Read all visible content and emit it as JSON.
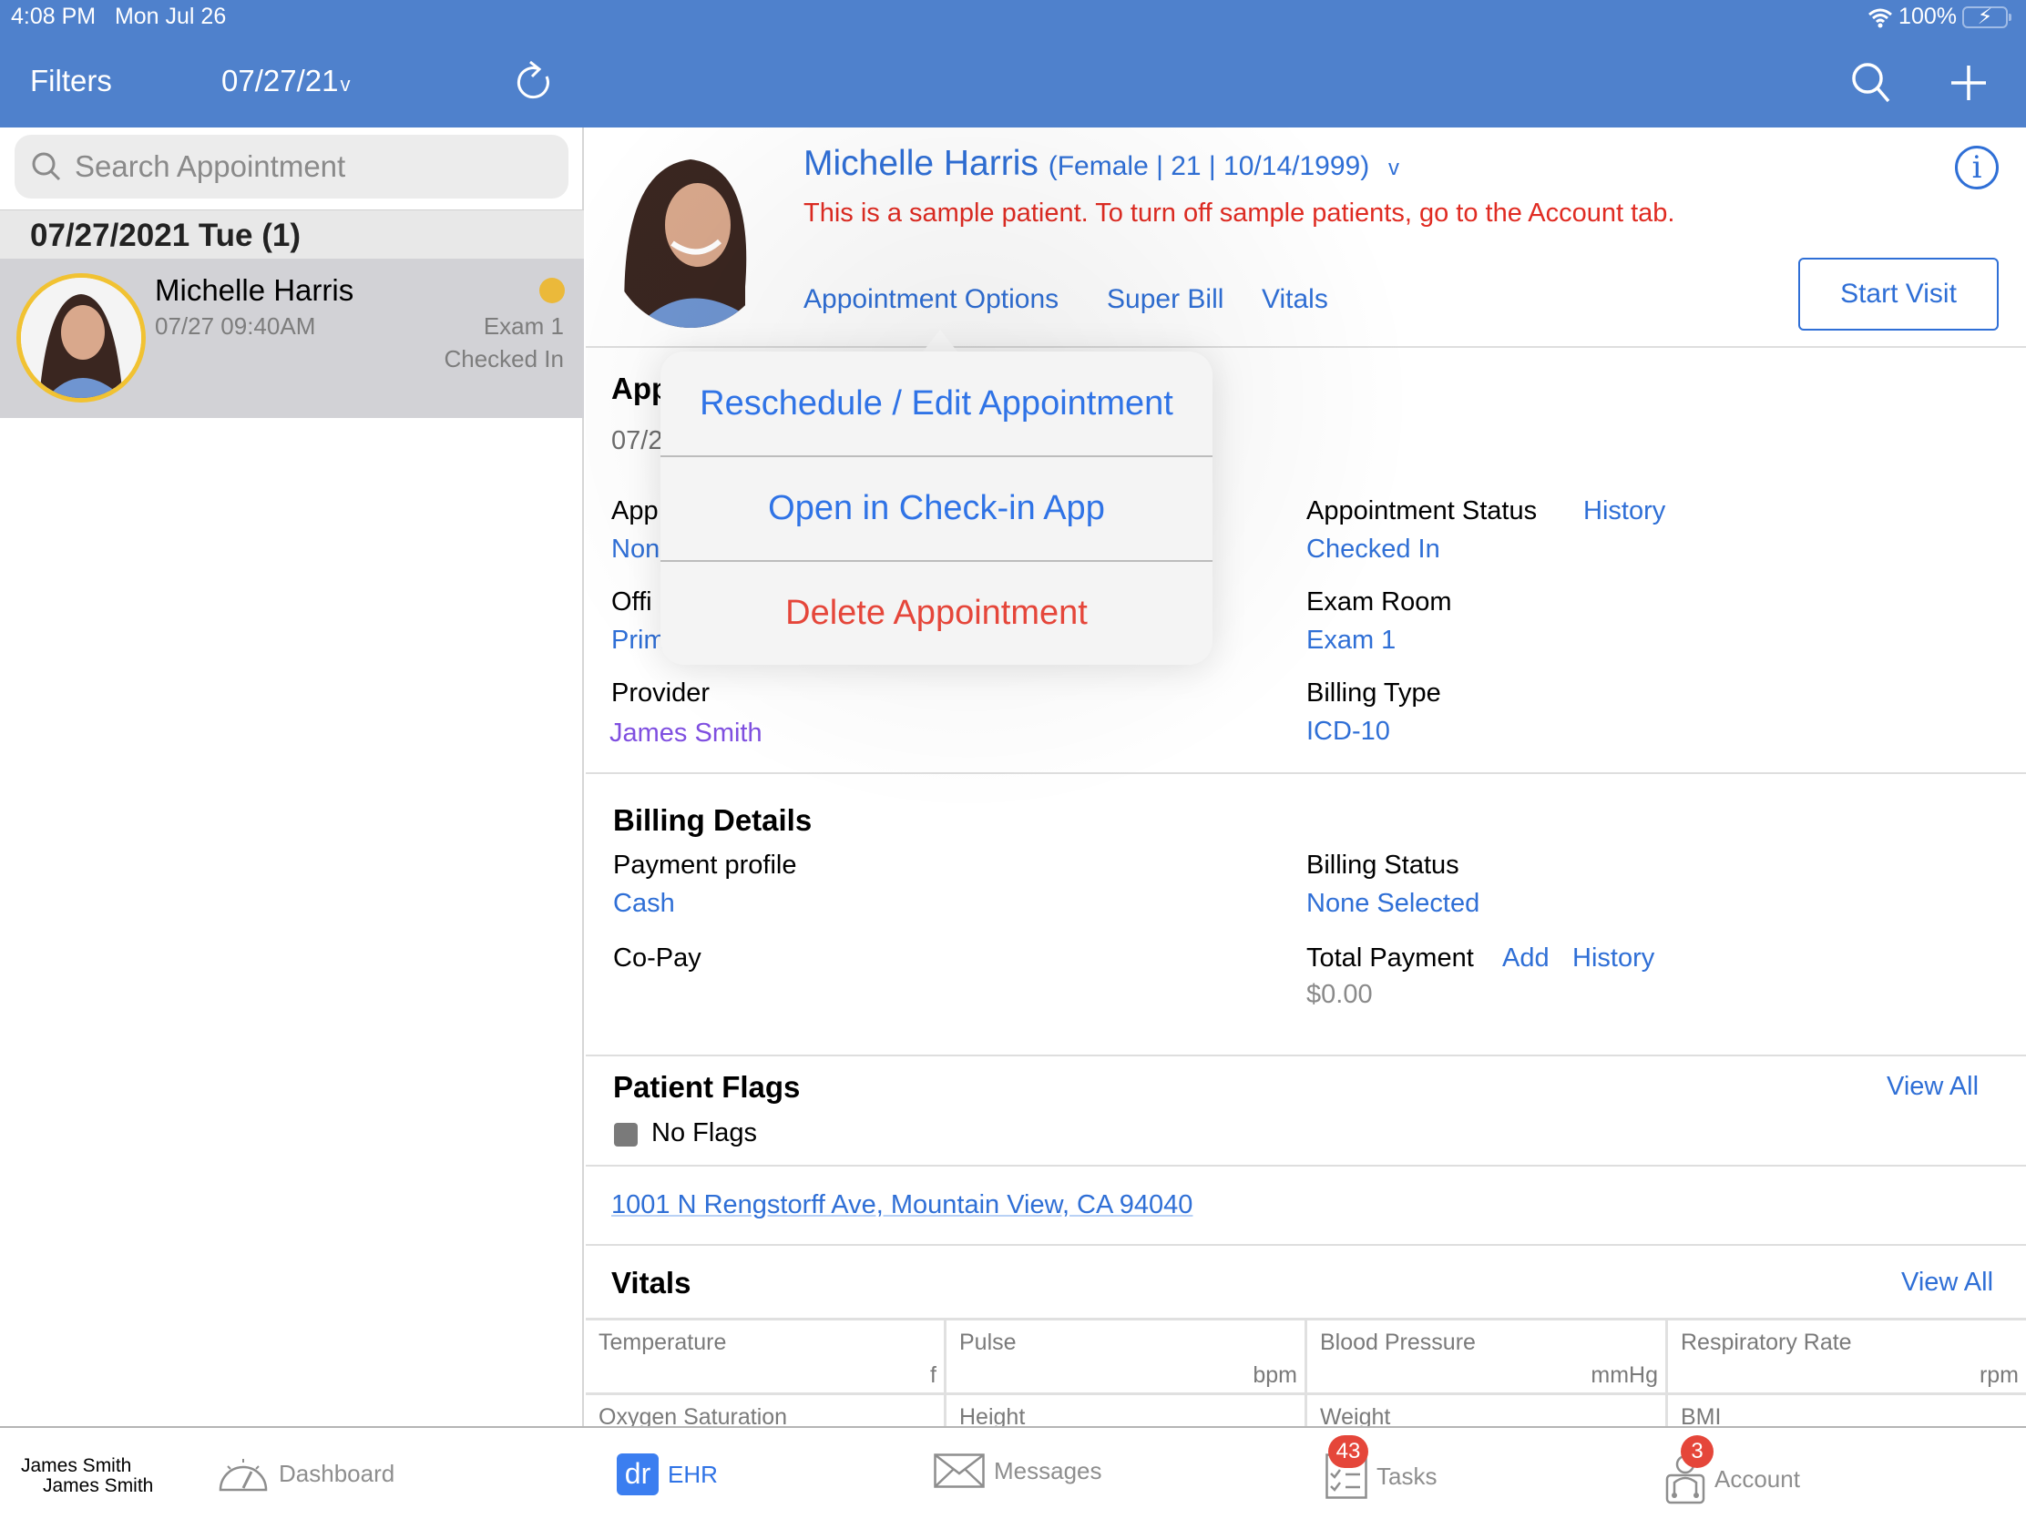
{
  "status_bar": {
    "time": "4:08 PM",
    "date": "Mon Jul 26",
    "battery": "100%"
  },
  "nav": {
    "filters_label": "Filters",
    "date_filter": "07/27/21",
    "chevron": "⌄"
  },
  "sidebar": {
    "search_placeholder": "Search Appointment",
    "section_header": "07/27/2021 Tue (1)",
    "appointments": [
      {
        "name": "Michelle Harris",
        "time": "07/27 09:40AM",
        "room": "Exam 1",
        "status": "Checked In",
        "status_color": "#ebb93a"
      }
    ]
  },
  "patient": {
    "name": "Michelle Harris",
    "demographics": "(Female | 21 | 10/14/1999)",
    "sample_warning": "This is a sample patient. To turn off sample patients, go to the Account tab.",
    "tabs": [
      "Appointment Options",
      "Super Bill",
      "Vitals"
    ],
    "start_visit": "Start Visit",
    "info_icon": "i"
  },
  "popover": {
    "items": [
      {
        "label": "Reschedule / Edit Appointment",
        "type": "normal"
      },
      {
        "label": "Open in Check-in App",
        "type": "normal"
      },
      {
        "label": "Delete Appointment",
        "type": "destructive"
      }
    ]
  },
  "appointment": {
    "title_partial": "App",
    "date_partial": "07/2",
    "type_label_partial": "App",
    "type_value_partial": "Non",
    "office_label_partial": "Offi",
    "office_value_partial": "Prim",
    "provider_label": "Provider",
    "provider_value": "James Smith",
    "status_label": "Appointment Status",
    "status_history": "History",
    "status_value": "Checked In",
    "exam_room_label": "Exam Room",
    "exam_room_value": "Exam 1",
    "billing_type_label": "Billing Type",
    "billing_type_value": "ICD-10"
  },
  "billing": {
    "title": "Billing Details",
    "payment_profile_label": "Payment profile",
    "payment_profile_value": "Cash",
    "billing_status_label": "Billing Status",
    "billing_status_value": "None Selected",
    "copay_label": "Co-Pay",
    "total_payment_label": "Total Payment",
    "add_label": "Add",
    "history_label": "History",
    "total_payment_value": "$0.00"
  },
  "flags": {
    "title": "Patient Flags",
    "view_all": "View All",
    "none": "No Flags"
  },
  "address": "1001 N Rengstorff Ave, Mountain View, CA 94040",
  "vitals": {
    "title": "Vitals",
    "view_all": "View All",
    "row1": [
      {
        "label": "Temperature",
        "unit": "f"
      },
      {
        "label": "Pulse",
        "unit": "bpm"
      },
      {
        "label": "Blood Pressure",
        "unit": "mmHg"
      },
      {
        "label": "Respiratory Rate",
        "unit": "rpm"
      }
    ],
    "row2": [
      {
        "label": "Oxygen Saturation"
      },
      {
        "label": "Height"
      },
      {
        "label": "Weight"
      },
      {
        "label": "BMI"
      }
    ]
  },
  "tabbar": {
    "user_line1": "James Smith",
    "user_line2": "James Smith",
    "tabs": [
      {
        "label": "Dashboard",
        "icon": "dashboard-icon",
        "active": false
      },
      {
        "label": "EHR",
        "icon": "dr",
        "active": true
      },
      {
        "label": "Messages",
        "icon": "messages-icon",
        "active": false
      },
      {
        "label": "Tasks",
        "icon": "tasks-icon",
        "active": false,
        "badge": "43"
      },
      {
        "label": "Account",
        "icon": "account-icon",
        "active": false,
        "badge": "3"
      }
    ]
  },
  "colors": {
    "nav_blue": "#4f81cc",
    "link_blue": "#2f6fd6",
    "warning_red": "#e02b22",
    "destructive_red": "#e5463a",
    "provider_purple": "#7f4fe0",
    "badge_red": "#e5463a"
  }
}
